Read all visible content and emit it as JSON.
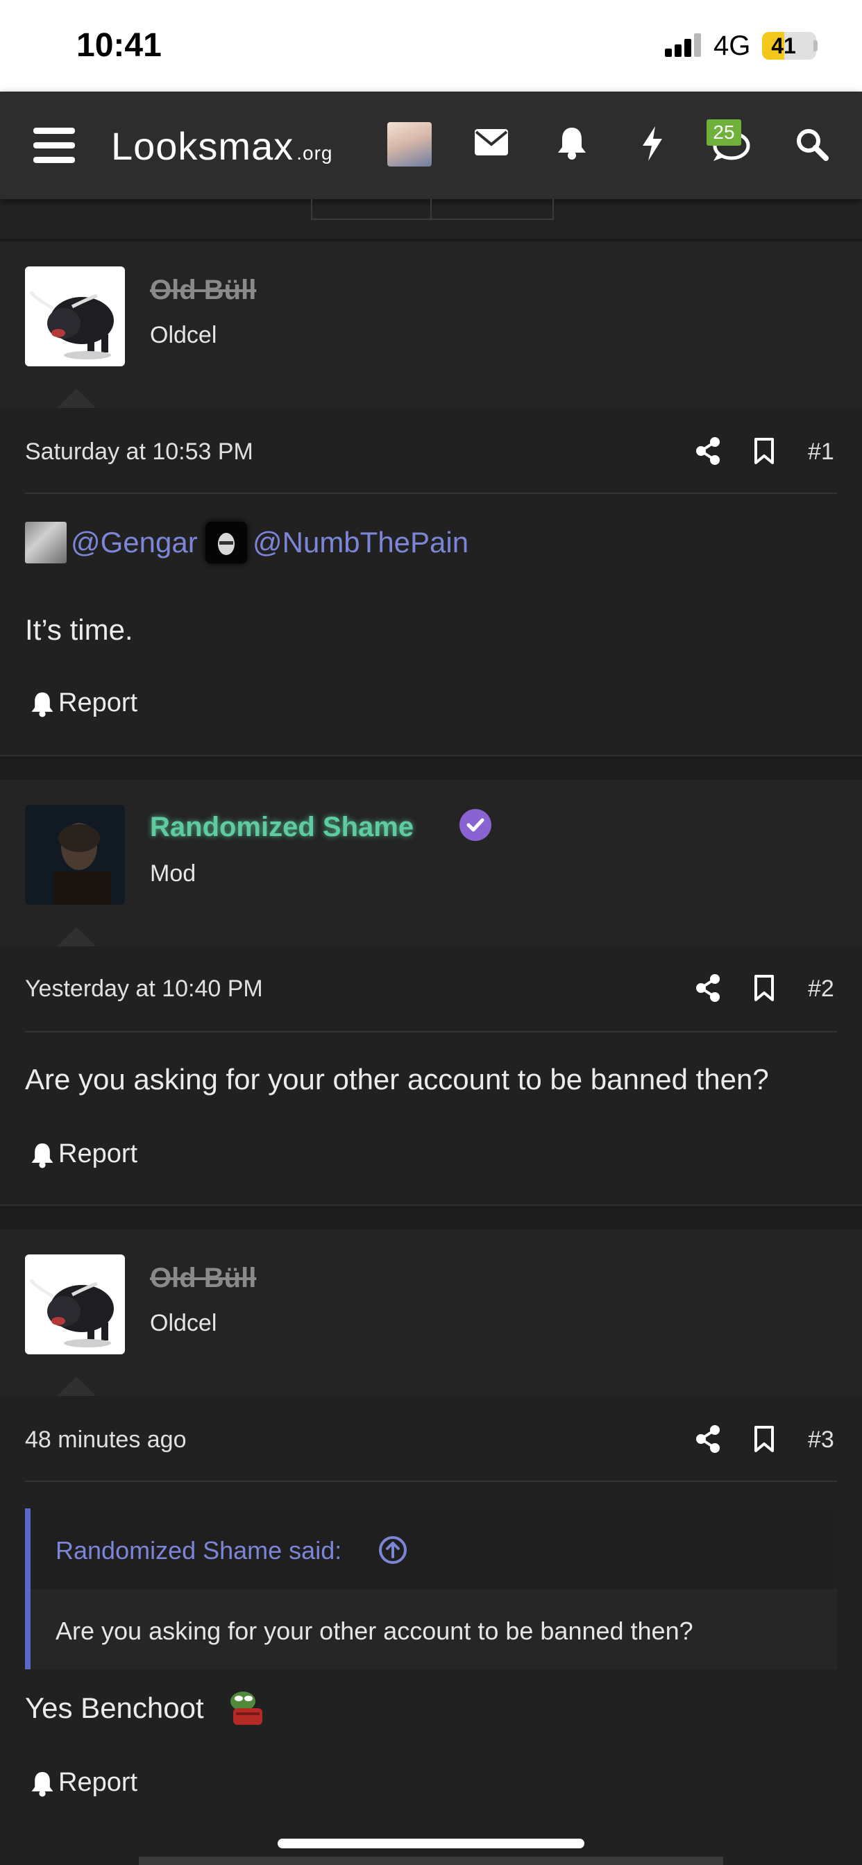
{
  "status_bar": {
    "time": "10:41",
    "network": "4G",
    "battery": "41",
    "battery_level": 0.41
  },
  "nav": {
    "logo_main": "Looksmax",
    "logo_suffix": ".org",
    "chat_badge": "25"
  },
  "posts": [
    {
      "username": "Old Büll",
      "title": "Oldcel",
      "date": "Saturday at 10:53 PM",
      "number": "#1",
      "mentions": [
        "@Gengar",
        "@NumbThePain"
      ],
      "text": "It’s time.",
      "report": "Report"
    },
    {
      "username": "Randomized Shame",
      "title": "Mod",
      "date": "Yesterday at 10:40 PM",
      "number": "#2",
      "text": "Are you asking for your other account to be banned then?",
      "report": "Report"
    },
    {
      "username": "Old Büll",
      "title": "Oldcel",
      "date": "48 minutes ago",
      "number": "#3",
      "quote_attribution": "Randomized Shame said:",
      "quote_text": "Are you asking for your other account to be banned then?",
      "text": "Yes Benchoot",
      "report": "Report"
    }
  ],
  "icons": [
    "menu-icon",
    "mail-icon",
    "bell-icon",
    "bolt-icon",
    "chat-icon",
    "search-icon",
    "share-icon",
    "bookmark-icon",
    "verified-icon",
    "arrow-up-circle-icon"
  ],
  "colors": {
    "background": "#232323",
    "navbar": "#2d2d2d",
    "link": "#7b86d6",
    "mod_name": "#5ecba0",
    "badge": "#6fb13a",
    "verified": "#8a63d2"
  }
}
